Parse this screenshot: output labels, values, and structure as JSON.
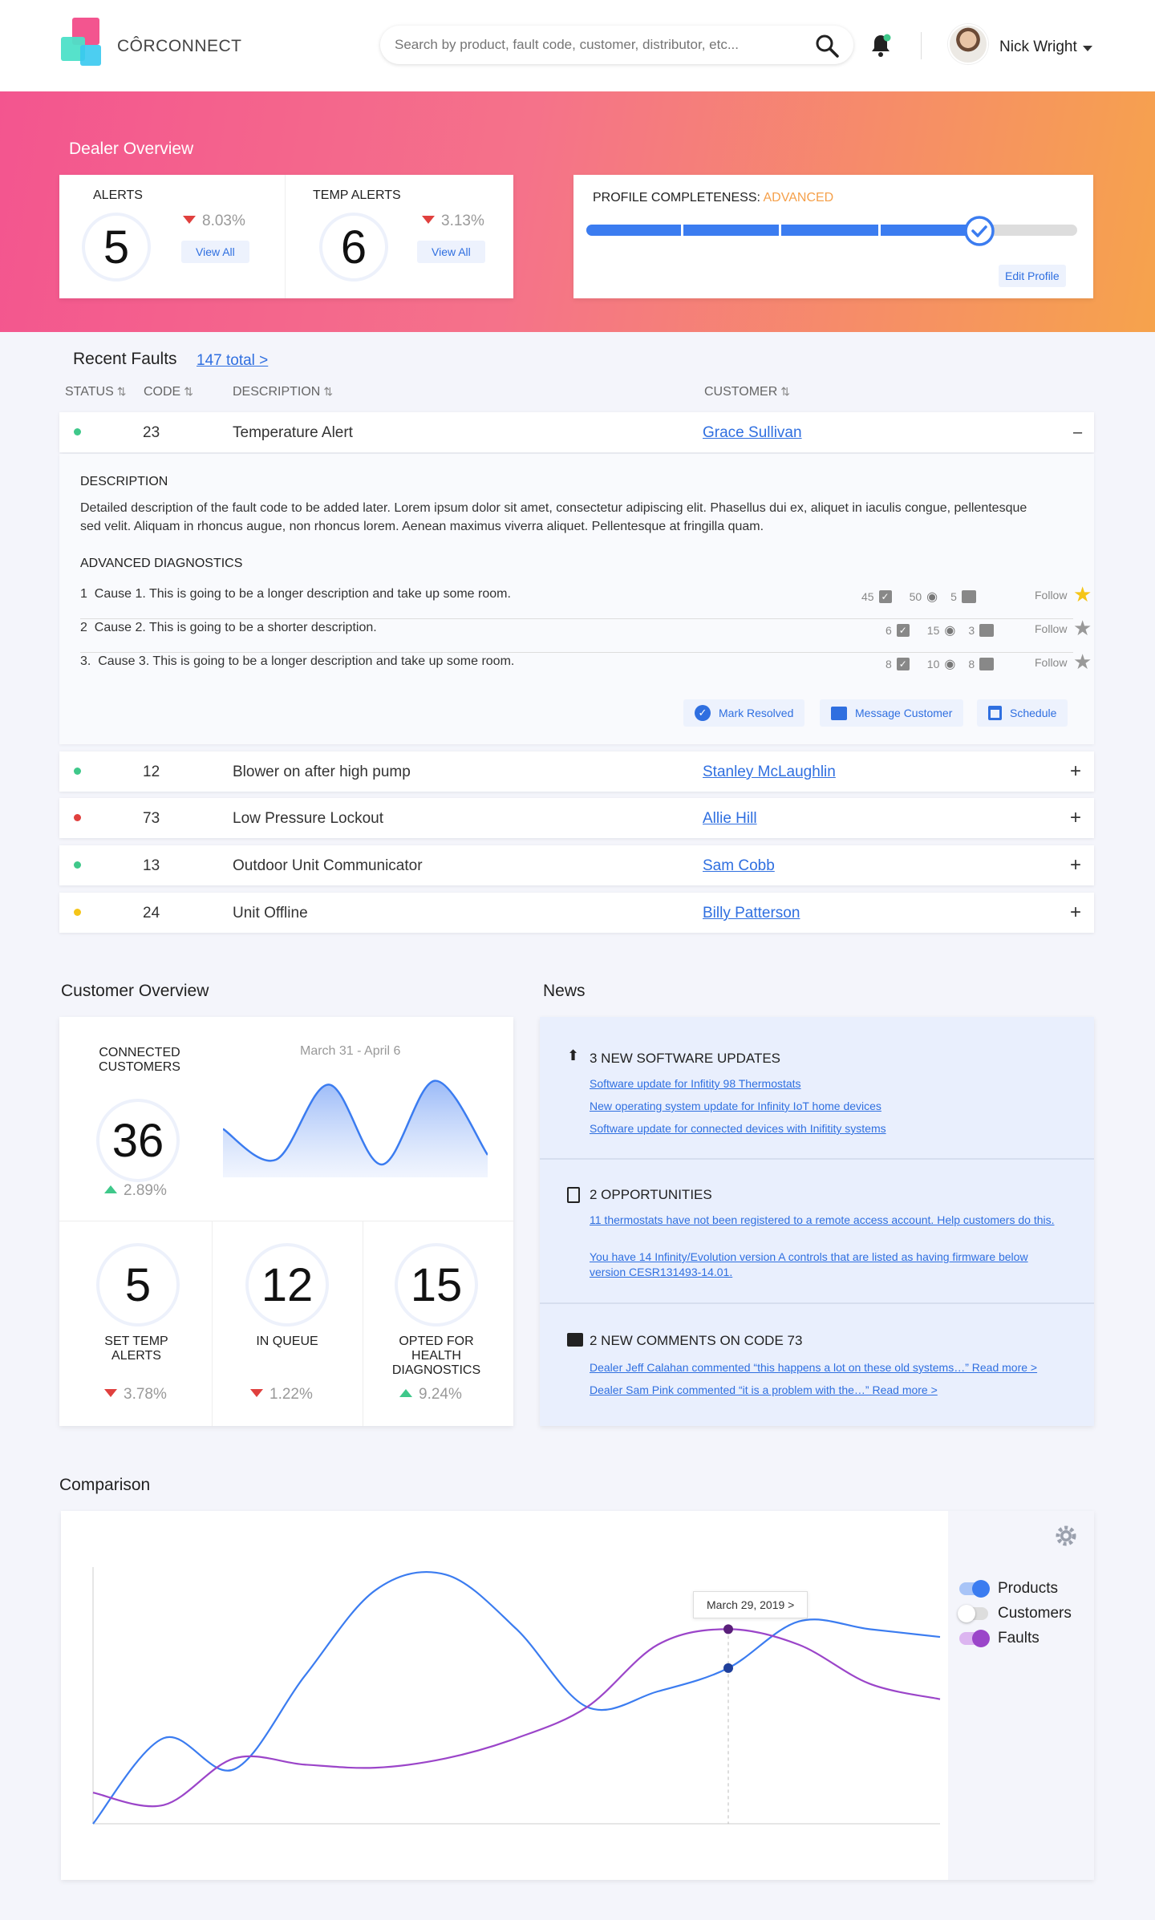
{
  "brand": {
    "name": "CÔRCONNECT"
  },
  "search": {
    "placeholder": "Search by product, fault code, customer, distributor, etc..."
  },
  "user": {
    "name": "Nick Wright"
  },
  "overview": {
    "title": "Dealer Overview",
    "alerts": {
      "label": "ALERTS",
      "value": "5",
      "delta": "8.03%",
      "button": "View All"
    },
    "temp_alerts": {
      "label": "TEMP ALERTS",
      "value": "6",
      "delta": "3.13%",
      "button": "View All"
    },
    "profile": {
      "label": "PROFILE COMPLETENESS:",
      "level": "ADVANCED",
      "progress": 0.8,
      "button": "Edit Profile"
    }
  },
  "faults": {
    "title": "Recent Faults",
    "total_link": "147 total >",
    "columns": {
      "status": "STATUS",
      "code": "CODE",
      "description": "DESCRIPTION",
      "customer": "CUSTOMER"
    },
    "expanded": {
      "code": "23",
      "description": "Temperature Alert",
      "customer": "Grace Sullivan",
      "toggle": "–",
      "desc_label": "DESCRIPTION",
      "desc_text": "Detailed description of the fault code to be added later. Lorem ipsum dolor sit amet, consectetur adipiscing elit. Phasellus dui ex, aliquet in iaculis congue, pellentesque sed velit. Aliquam in rhoncus augue, non rhoncus lorem. Aenean maximus viverra aliquet. Pellentesque at fringilla quam.",
      "diag_label": "ADVANCED DIAGNOSTICS",
      "causes": [
        {
          "num": "1",
          "text": "Cause 1. This is going to be a longer description and take up some room.",
          "checks": "45",
          "views": "50",
          "comments": "5",
          "follow": "Follow",
          "starred": true
        },
        {
          "num": "2",
          "text": "Cause 2. This is going to be a shorter description.",
          "checks": "6",
          "views": "15",
          "comments": "3",
          "follow": "Follow",
          "starred": false
        },
        {
          "num": "3.",
          "text": "Cause 3. This is going to be a longer description and take up some room.",
          "checks": "8",
          "views": "10",
          "comments": "8",
          "follow": "Follow",
          "starred": false
        }
      ],
      "actions": {
        "resolve": "Mark Resolved",
        "message": "Message Customer",
        "schedule": "Schedule"
      }
    },
    "rows": [
      {
        "code": "12",
        "description": "Blower on after high pump",
        "customer": "Stanley McLaughlin",
        "status_color": "#3fc88a",
        "toggle": "+"
      },
      {
        "code": "73",
        "description": "Low Pressure Lockout",
        "customer": "Allie Hill",
        "status_color": "#e0403e",
        "toggle": "+"
      },
      {
        "code": "13",
        "description": "Outdoor Unit Communicator",
        "customer": "Sam Cobb",
        "status_color": "#3fc88a",
        "toggle": "+"
      },
      {
        "code": "24",
        "description": "Unit Offline",
        "customer": "Billy Patterson",
        "status_color": "#f5c518",
        "toggle": "+"
      }
    ]
  },
  "customer_overview": {
    "title": "Customer Overview",
    "connected": {
      "label": "CONNECTED CUSTOMERS",
      "value": "36",
      "delta": "2.89%"
    },
    "range": "March 31 - April 6",
    "sparkline": [
      0.42,
      0.1,
      0.88,
      0.05,
      0.92,
      0.15
    ],
    "stats": [
      {
        "value": "5",
        "label": "SET TEMP ALERTS",
        "delta": "3.78%",
        "dir": "down"
      },
      {
        "value": "12",
        "label": "IN QUEUE",
        "delta": "1.22%",
        "dir": "down"
      },
      {
        "value": "15",
        "label": "OPTED FOR HEALTH DIAGNOSTICS",
        "delta": "9.24%",
        "dir": "up"
      }
    ]
  },
  "news": {
    "title": "News",
    "blocks": [
      {
        "icon": "upload-icon",
        "title": "3 NEW SOFTWARE UPDATES",
        "links": [
          "Software update for Infitity 98 Thermostats",
          "New operating system update for Infinity IoT home devices",
          "Software update for connected devices with Inifitity systems"
        ]
      },
      {
        "icon": "clipboard-icon",
        "title": "2 OPPORTUNITIES",
        "links": [
          "11 thermostats have not been registered to a remote access account. Help customers do this.",
          "You have 14 Infinity/Evolution version A controls that are listed as having firmware below version CESR131493-14.01."
        ]
      },
      {
        "icon": "comment-icon",
        "title": "2 NEW COMMENTS ON CODE 73",
        "links": [
          "Dealer Jeff Calahan commented “this happens a lot on these old systems…” Read more >",
          "Dealer Sam Pink commented “it is a problem with the…” Read more >"
        ]
      }
    ]
  },
  "comparison": {
    "title": "Comparison",
    "tooltip": "March 29, 2019 >",
    "legend": [
      {
        "name": "Products",
        "on": true,
        "color": "#3b7cf0"
      },
      {
        "name": "Customers",
        "on": false,
        "color": "#cccccc"
      },
      {
        "name": "Faults",
        "on": true,
        "color": "#9b45c9"
      }
    ]
  },
  "chart_data": {
    "type": "line",
    "title": "Comparison",
    "x": [
      0,
      1,
      2,
      3,
      4,
      5,
      6,
      7,
      8,
      9,
      10,
      11,
      12
    ],
    "series": [
      {
        "name": "Products",
        "values": [
          0,
          55,
          35,
          95,
          150,
          160,
          125,
          75,
          85,
          100,
          130,
          125,
          120
        ]
      },
      {
        "name": "Faults",
        "values": [
          20,
          12,
          42,
          38,
          36,
          42,
          55,
          75,
          115,
          125,
          115,
          90,
          80
        ]
      }
    ],
    "ylim": [
      0,
      170
    ],
    "grid": false,
    "legend": "right"
  }
}
